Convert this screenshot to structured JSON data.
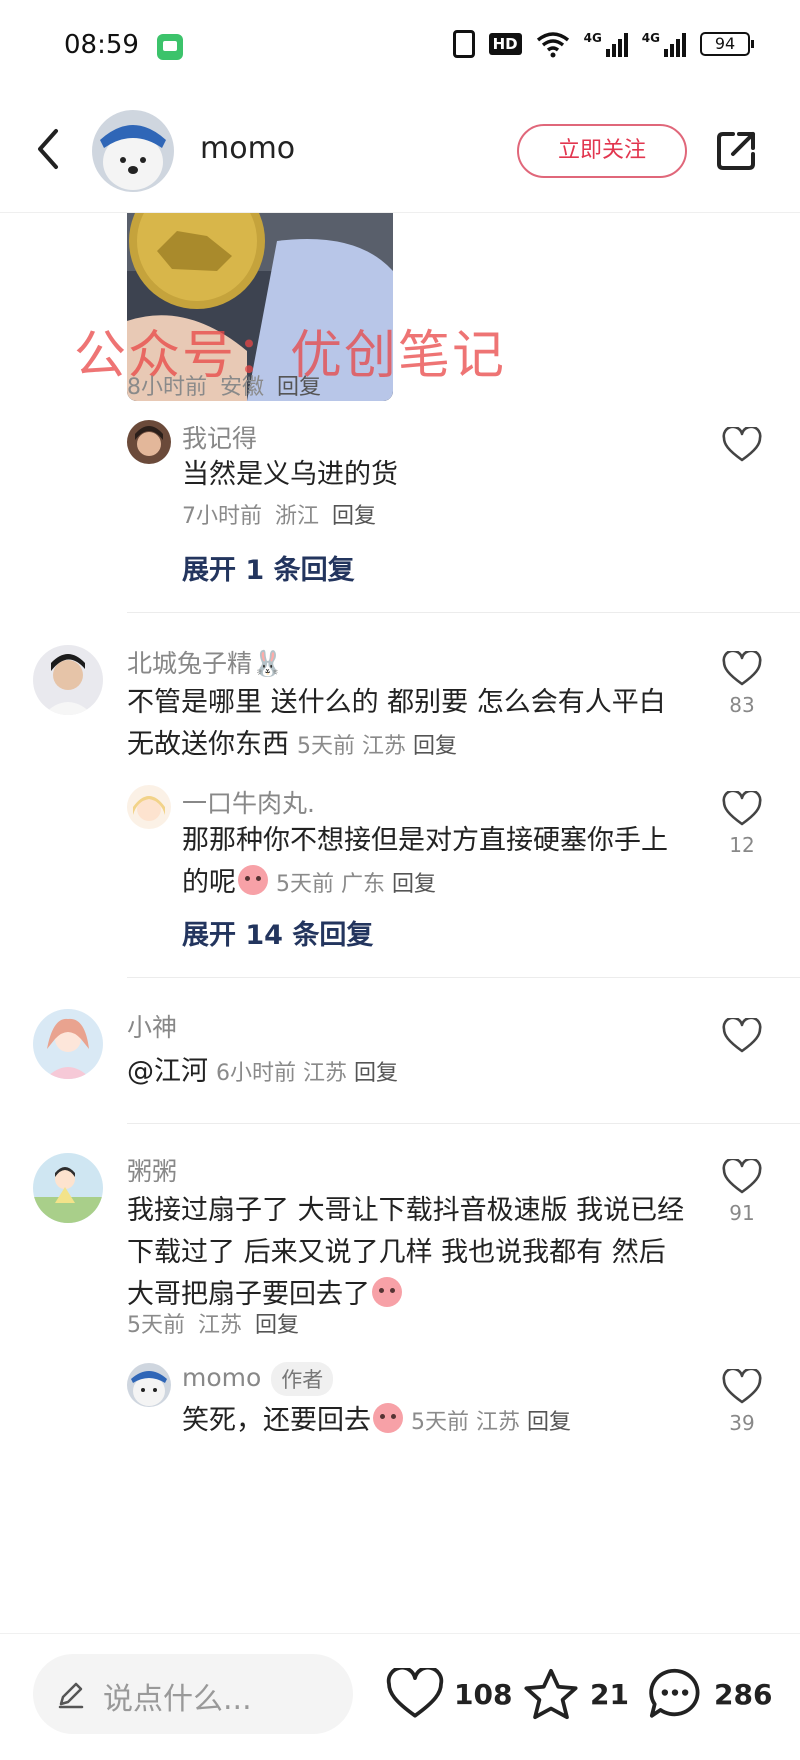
{
  "status_bar": {
    "time": "08:59",
    "hd_label": "HD",
    "network_1": "4G",
    "network_2": "4G",
    "battery": "94"
  },
  "header": {
    "username": "momo",
    "follow_label": "立即关注"
  },
  "post": {
    "watermark": "公众号：优创笔记",
    "meta_time": "8小时前",
    "meta_location": "安徽",
    "reply_label": "回复"
  },
  "comments": [
    {
      "username": "我记得",
      "text": "当然是义乌进的货",
      "time": "7小时前",
      "location": "浙江",
      "reply_label": "回复",
      "expand_label": "展开 1 条回复"
    },
    {
      "username": "北城兔子精🐰",
      "text": "不管是哪里 送什么的 都别要 怎么会有人平白无故送你东西",
      "time": "5天前",
      "location": "江苏",
      "reply_label": "回复",
      "likes": "83",
      "reply": {
        "username": "一口牛肉丸.",
        "text": "那那种你不想接但是对方直接硬塞你手上的呢",
        "time": "5天前",
        "location": "广东",
        "reply_label": "回复",
        "likes": "12"
      },
      "expand_label": "展开 14 条回复"
    },
    {
      "username": "小神",
      "text": "@江河",
      "time": "6小时前",
      "location": "江苏",
      "reply_label": "回复"
    },
    {
      "username": "粥粥",
      "text": "我接过扇子了 大哥让下载抖音极速版 我说已经下载过了 后来又说了几样 我也说我都有 然后大哥把扇子要回去了",
      "time": "5天前",
      "location": "江苏",
      "reply_label": "回复",
      "likes": "91",
      "reply": {
        "username": "momo",
        "author_tag": "作者",
        "text": "笑死，还要回去",
        "time": "5天前",
        "location": "江苏",
        "reply_label": "回复",
        "likes": "39"
      }
    }
  ],
  "bottom_bar": {
    "input_placeholder": "说点什么...",
    "likes": "108",
    "favorites": "21",
    "comments": "286"
  },
  "colors": {
    "follow_red": "#e2364f",
    "expand_blue": "#23355e"
  }
}
